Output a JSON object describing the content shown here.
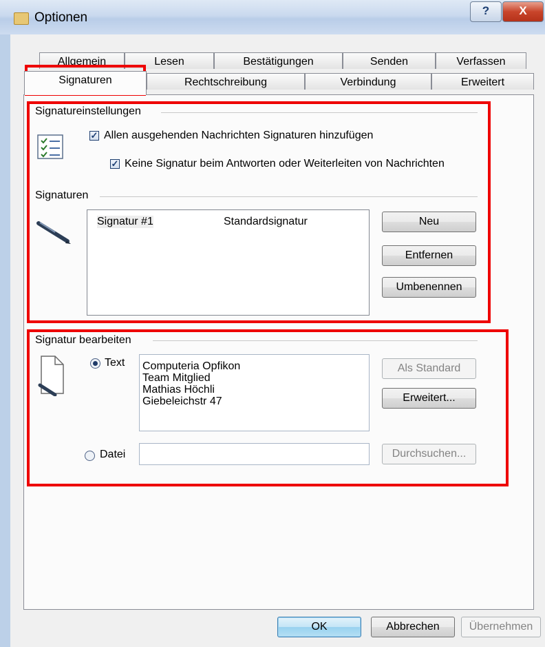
{
  "window": {
    "title": "Optionen",
    "help_glyph": "?",
    "close_glyph": "X"
  },
  "tabs": {
    "row1": [
      "Allgemein",
      "Lesen",
      "Bestätigungen",
      "Senden",
      "Verfassen"
    ],
    "row2": [
      "Signaturen",
      "Rechtschreibung",
      "Verbindung",
      "Erweitert"
    ],
    "selected": "Signaturen"
  },
  "settings": {
    "group_label": "Signatureinstellungen",
    "add_all_label": "Allen ausgehenden Nachrichten Signaturen hinzufügen",
    "add_all_checked": true,
    "no_reply_label": "Keine Signatur beim Antworten oder Weiterleiten von Nachrichten",
    "no_reply_checked": true
  },
  "signatures": {
    "group_label": "Signaturen",
    "list": [
      {
        "name": "Signatur #1",
        "type": "Standardsignatur"
      }
    ],
    "buttons": {
      "new": "Neu",
      "remove": "Entfernen",
      "rename": "Umbenennen"
    }
  },
  "edit": {
    "group_label": "Signatur bearbeiten",
    "text_option": "Text",
    "text_selected": true,
    "text_lines": [
      "Computeria Opfikon",
      "Team Mitglied",
      "Mathias Höchli",
      "Giebeleichstr 47"
    ],
    "file_option": "Datei",
    "file_value": "",
    "buttons": {
      "set_default": "Als Standard",
      "advanced": "Erweitert...",
      "browse": "Durchsuchen..."
    }
  },
  "footer": {
    "ok": "OK",
    "cancel": "Abbrechen",
    "apply": "Übernehmen"
  },
  "colors": {
    "highlight_box": "#ee0000",
    "dialog_bg": "#f0f0f0"
  }
}
